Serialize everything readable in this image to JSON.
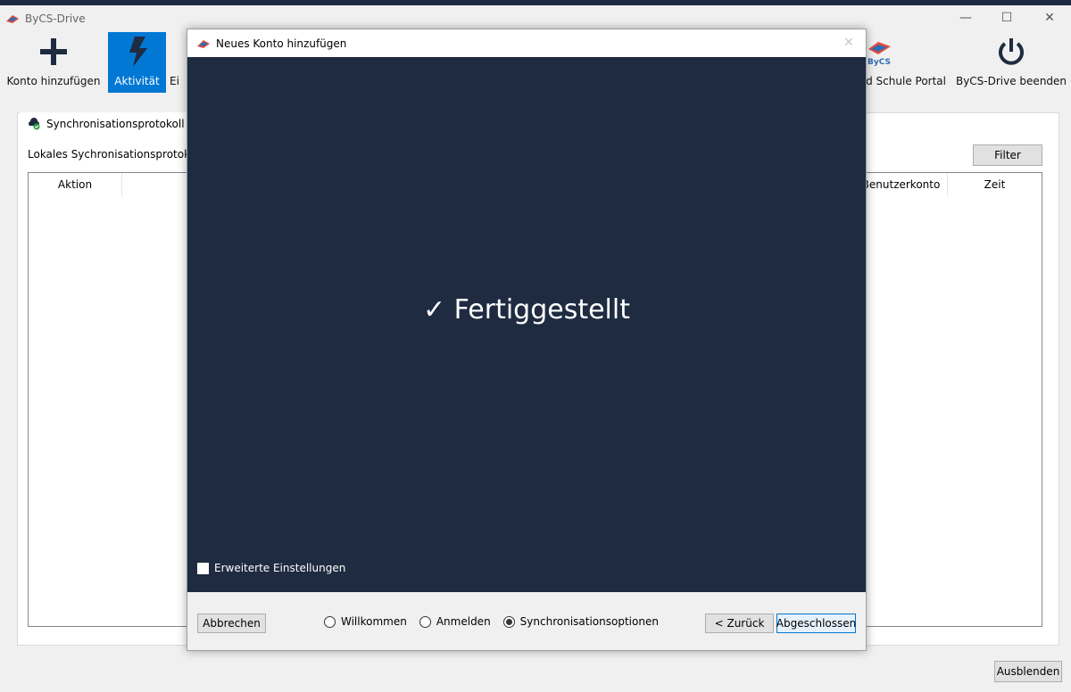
{
  "window": {
    "title": "ByCS-Drive",
    "controls": {
      "minimize": "—",
      "maximize": "☐",
      "close": "✕"
    }
  },
  "toolbar": {
    "add_account": "Konto hinzufügen",
    "activity": "Aktivität",
    "settings_partial": "Ei",
    "portal_partial": "d Schule Portal",
    "quit": "ByCS-Drive beenden",
    "bycs_logo_text": "ByCS"
  },
  "panel": {
    "tab": "Synchronisationsprotokoll",
    "label": "Lokales Sychronisationsprotokol",
    "filter": "Filter",
    "columns": {
      "action": "Aktion",
      "user_account": "Benutzerkonto",
      "time": "Zeit"
    }
  },
  "footer": {
    "hide_button": "Ausblenden"
  },
  "dialog": {
    "title": "Neues Konto hinzufügen",
    "close": "✕",
    "status": "✓ Fertiggestellt",
    "advanced": "Erweiterte Einstellungen",
    "cancel": "Abbrechen",
    "steps": [
      "Willkommen",
      "Anmelden",
      "Synchronisationsoptionen"
    ],
    "selected_step": "Synchronisationsoptionen",
    "back": "< Zurück",
    "finish": "Abgeschlossen"
  },
  "colors": {
    "accent": "#0078d4",
    "dialog_bg": "#1e2b40",
    "topbar": "#1f2a44"
  }
}
